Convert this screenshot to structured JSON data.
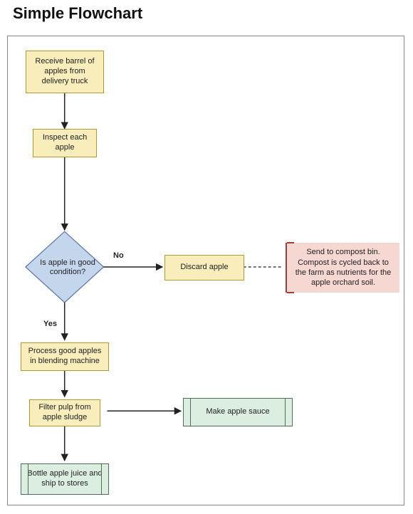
{
  "title": "Simple Flowchart",
  "nodes": {
    "start": {
      "label": "Receive barrel of apples from delivery truck"
    },
    "inspect": {
      "label": "Inspect each apple"
    },
    "decision": {
      "label": "Is apple in good condition?"
    },
    "discard": {
      "label": "Discard apple"
    },
    "process": {
      "label": "Process good apples in blending machine"
    },
    "filter": {
      "label": "Filter pulp from apple sludge"
    },
    "sauce": {
      "label": "Make apple sauce"
    },
    "bottle": {
      "label": "Bottle apple juice and ship to stores"
    },
    "annotation": {
      "label": "Send to compost bin. Compost is cycled back to the farm as nutrients for the apple orchard soil."
    }
  },
  "edges": {
    "decision_no": "No",
    "decision_yes": "Yes"
  },
  "chart_data": {
    "type": "flowchart",
    "title": "Simple Flowchart",
    "nodes": [
      {
        "id": "start",
        "shape": "process",
        "label": "Receive barrel of apples from delivery truck"
      },
      {
        "id": "inspect",
        "shape": "process",
        "label": "Inspect each apple"
      },
      {
        "id": "decision",
        "shape": "decision",
        "label": "Is apple in good condition?"
      },
      {
        "id": "discard",
        "shape": "process",
        "label": "Discard apple"
      },
      {
        "id": "process",
        "shape": "process",
        "label": "Process good apples in blending machine"
      },
      {
        "id": "filter",
        "shape": "process",
        "label": "Filter pulp from apple sludge"
      },
      {
        "id": "sauce",
        "shape": "predefined-process",
        "label": "Make apple sauce"
      },
      {
        "id": "bottle",
        "shape": "predefined-process",
        "label": "Bottle apple juice and ship to stores"
      },
      {
        "id": "ann1",
        "shape": "annotation",
        "label": "Send to compost bin. Compost is cycled back to the farm as nutrients for the apple orchard soil."
      }
    ],
    "edges": [
      {
        "from": "start",
        "to": "inspect"
      },
      {
        "from": "inspect",
        "to": "decision"
      },
      {
        "from": "decision",
        "to": "discard",
        "label": "No"
      },
      {
        "from": "decision",
        "to": "process",
        "label": "Yes"
      },
      {
        "from": "process",
        "to": "filter"
      },
      {
        "from": "filter",
        "to": "sauce"
      },
      {
        "from": "filter",
        "to": "bottle"
      },
      {
        "from": "discard",
        "to": "ann1",
        "type": "annotation"
      }
    ],
    "colors": {
      "process_fill": "#f8edbb",
      "process_border": "#b09a2e",
      "decision_fill": "#c4d6ec",
      "decision_border": "#5f7ca6",
      "predef_fill": "#dceee0",
      "predef_border": "#4f6e56",
      "annotation_fill": "#f6d7d2",
      "annotation_border": "#a33b3b",
      "connector": "#222222"
    }
  }
}
